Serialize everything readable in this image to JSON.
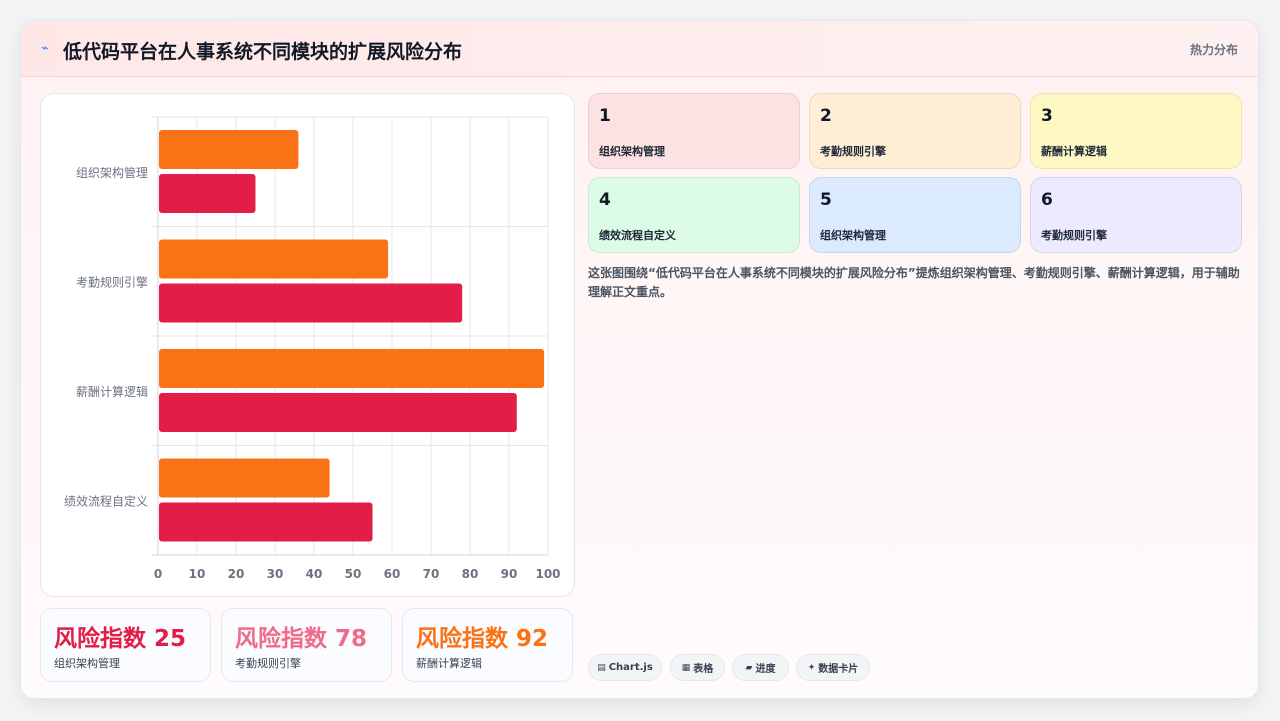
{
  "header": {
    "icon": "chart-line-icon",
    "title": "低代码平台在人事系统不同模块的扩展风险分布",
    "badge": "热力分布"
  },
  "chart_data": {
    "type": "bar",
    "orientation": "horizontal",
    "categories": [
      "组织架构管理",
      "考勤规则引擎",
      "薪酬计算逻辑",
      "绩效流程自定义"
    ],
    "series": [
      {
        "values": [
          36,
          59,
          99,
          44
        ],
        "color": "#f97316"
      },
      {
        "values": [
          25,
          78,
          92,
          55
        ],
        "color": "#e11d48"
      }
    ],
    "xlim": [
      0,
      100
    ],
    "xticks": [
      "0",
      "10",
      "20",
      "30",
      "40",
      "50",
      "60",
      "70",
      "80",
      "90",
      "100"
    ],
    "grid": true
  },
  "metrics": [
    {
      "value": "风险指数 25",
      "label": "组织架构管理",
      "color": "#e11d48"
    },
    {
      "value": "风险指数 78",
      "label": "考勤规则引擎",
      "color": "#f06b8a"
    },
    {
      "value": "风险指数 92",
      "label": "薪酬计算逻辑",
      "color": "#f97316"
    }
  ],
  "tiles": [
    {
      "num": "1",
      "label": "组织架构管理",
      "bg": "#fde2e4"
    },
    {
      "num": "2",
      "label": "考勤规则引擎",
      "bg": "#ffedd5"
    },
    {
      "num": "3",
      "label": "薪酬计算逻辑",
      "bg": "#fef9c3"
    },
    {
      "num": "4",
      "label": "绩效流程自定义",
      "bg": "#dcfce7"
    },
    {
      "num": "5",
      "label": "组织架构管理",
      "bg": "#dbeafe"
    },
    {
      "num": "6",
      "label": "考勤规则引擎",
      "bg": "#ede9fe"
    }
  ],
  "description": "这张图围绕“低代码平台在人事系统不同模块的扩展风险分布”提炼组织架构管理、考勤规则引擎、薪酬计算逻辑，用于辅助理解正文重点。",
  "pills": [
    {
      "icon": "chart-icon",
      "glyph": "▤",
      "label": "Chart.js"
    },
    {
      "icon": "table-icon",
      "glyph": "▦",
      "label": "表格"
    },
    {
      "icon": "progress-icon",
      "glyph": "▰",
      "label": "进度"
    },
    {
      "icon": "sparkle-icon",
      "glyph": "✦",
      "label": "数据卡片"
    }
  ]
}
